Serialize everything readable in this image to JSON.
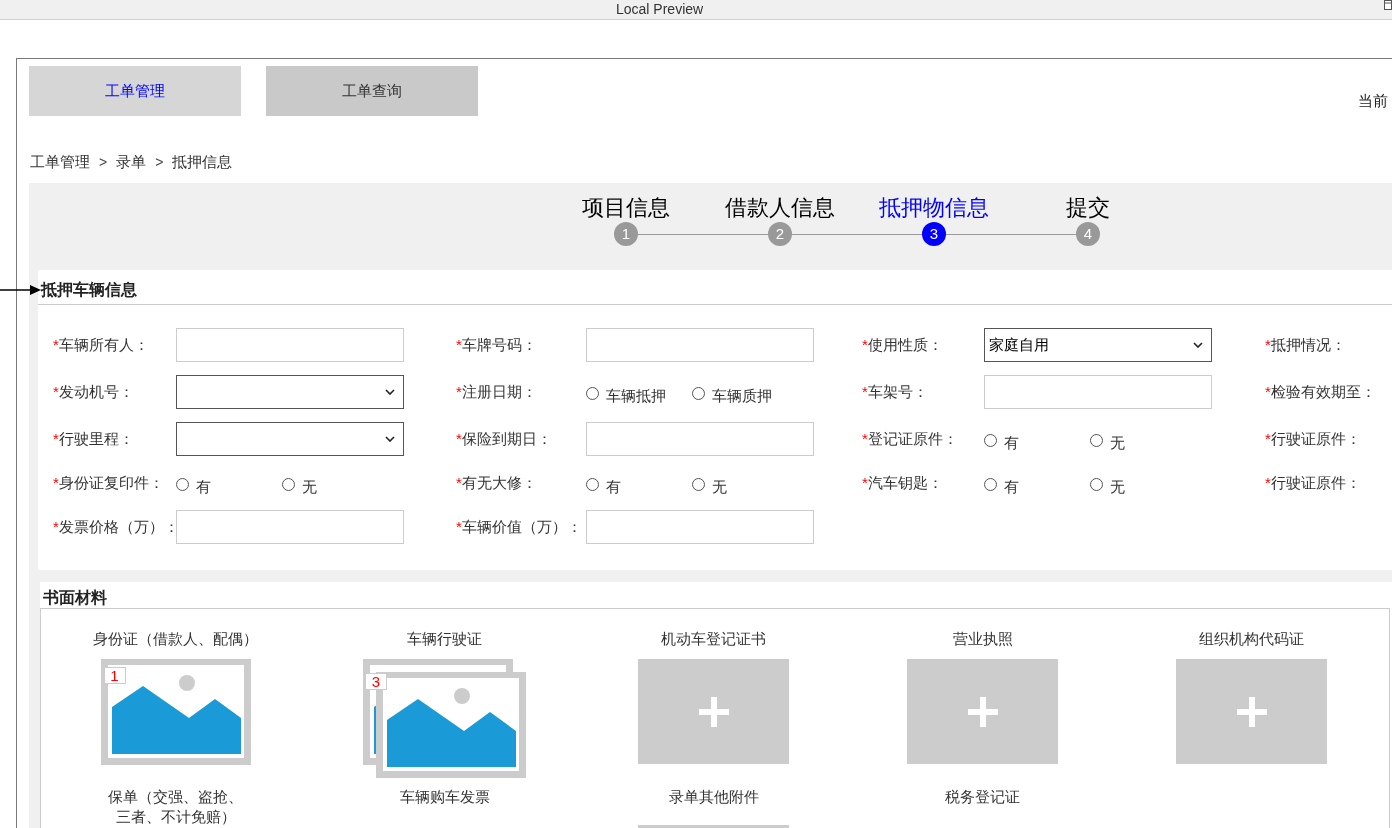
{
  "window": {
    "title": "Local Preview"
  },
  "tabs": [
    {
      "label": "工单管理",
      "selected": true
    },
    {
      "label": "工单查询",
      "selected": false
    }
  ],
  "header_right": {
    "text": "当前"
  },
  "breadcrumb": [
    {
      "kind": "link",
      "text": "工单管理"
    },
    {
      "kind": "separator",
      "text": ">"
    },
    {
      "kind": "link",
      "text": "录单"
    },
    {
      "kind": "separator",
      "text": ">"
    },
    {
      "kind": "link",
      "text": "抵押信息"
    }
  ],
  "steps": [
    {
      "label": "项目信息",
      "number": "1",
      "selected": false
    },
    {
      "label": "借款人信息",
      "number": "2",
      "selected": false
    },
    {
      "label": "抵押物信息",
      "number": "3",
      "selected": true
    },
    {
      "label": "提交",
      "number": "4",
      "selected": false
    }
  ],
  "vehicle_section": {
    "title": "抵押车辆信息",
    "rows": [
      [
        {
          "mark": "*",
          "label": "车辆所有人：",
          "kind": "text"
        },
        {
          "mark": "*",
          "label": "车牌号码：",
          "kind": "text"
        },
        {
          "mark": "*",
          "label": "使用性质：",
          "kind": "select",
          "value": "家庭自用"
        },
        {
          "mark": "*",
          "label": "抵押情况：",
          "kind": "label"
        }
      ],
      [
        {
          "mark": "*",
          "label": "发动机号：",
          "kind": "select"
        },
        {
          "mark": "*",
          "label": "注册日期：",
          "kind": "radio",
          "options": [
            {
              "label": "车辆抵押",
              "selected": false
            },
            {
              "label": "车辆质押",
              "selected": false
            }
          ]
        },
        {
          "mark": "*",
          "label": "车架号：",
          "kind": "text"
        },
        {
          "mark": "*",
          "label": "检验有效期至：",
          "kind": "label"
        }
      ],
      [
        {
          "mark": "*",
          "label": "行驶里程：",
          "kind": "select"
        },
        {
          "mark": "*",
          "label": "保险到期日：",
          "kind": "text"
        },
        {
          "mark": "*",
          "label": "登记证原件：",
          "kind": "radio",
          "options": [
            {
              "label": "有",
              "selected": false
            },
            {
              "label": "无",
              "selected": false
            }
          ]
        },
        {
          "mark": "*",
          "label": "行驶证原件：",
          "kind": "label"
        }
      ],
      [
        {
          "mark": "*",
          "label": "身份证复印件：",
          "kind": "radio",
          "options": [
            {
              "label": "有",
              "selected": false
            },
            {
              "label": "无",
              "selected": false
            }
          ]
        },
        {
          "mark": "*",
          "label": "有无大修：",
          "kind": "radio",
          "options": [
            {
              "label": "有",
              "selected": false
            },
            {
              "label": "无",
              "selected": false
            }
          ]
        },
        {
          "mark": "*",
          "label": "汽车钥匙：",
          "kind": "radio",
          "options": [
            {
              "label": "有",
              "selected": false
            },
            {
              "label": "无",
              "selected": false
            }
          ]
        },
        {
          "mark": "*",
          "label": "行驶证原件：",
          "kind": "label"
        }
      ],
      [
        {
          "mark": "*",
          "label": "发票价格（万）：",
          "kind": "text"
        },
        {
          "mark": "*",
          "label": "车辆价值（万）：",
          "kind": "text"
        }
      ]
    ]
  },
  "materials_section": {
    "title": "书面材料",
    "items": [
      {
        "label": "身份证（借款人、配偶）",
        "kind": "photo",
        "count": "1"
      },
      {
        "label": "车辆行驶证",
        "kind": "stack",
        "count": "3"
      },
      {
        "label": "机动车登记证书",
        "kind": "add"
      },
      {
        "label": "营业执照",
        "kind": "add"
      },
      {
        "label": "组织机构代码证",
        "kind": "add"
      },
      {
        "label": "保单（交强、盗抢、三者、不计免赔）",
        "kind": "caption"
      },
      {
        "label": "车辆购车发票",
        "kind": "caption"
      },
      {
        "label": "录单其他附件",
        "kind": "edge"
      },
      {
        "label": "税务登记证",
        "kind": "caption"
      }
    ]
  }
}
